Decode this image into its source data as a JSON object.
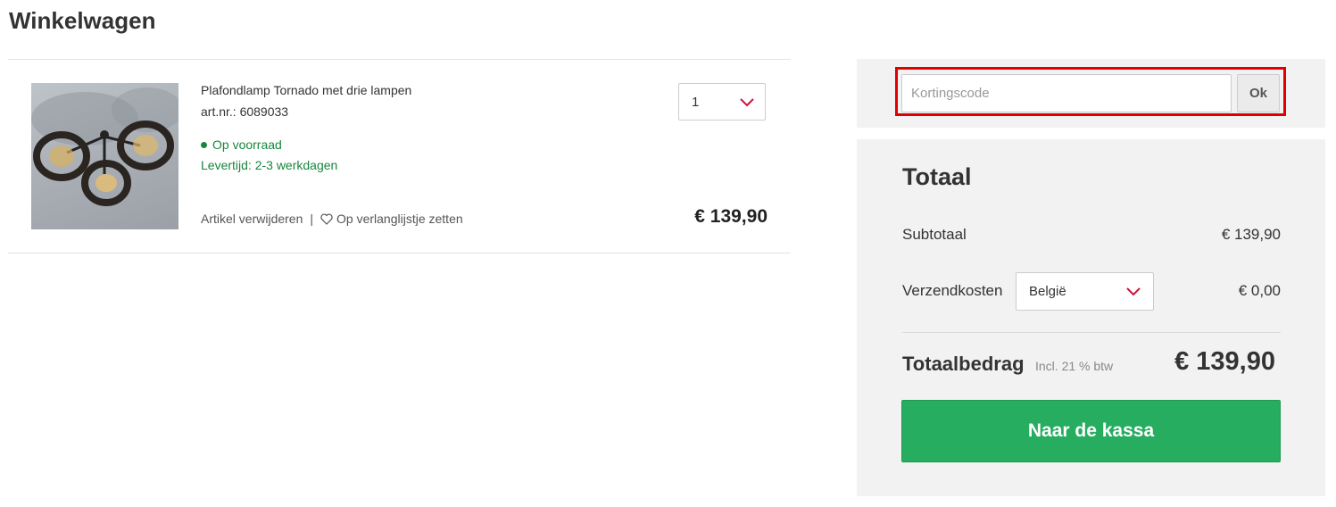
{
  "page": {
    "title": "Winkelwagen"
  },
  "cart_item": {
    "name": "Plafondlamp Tornado met drie lampen",
    "sku": "art.nr.: 6089033",
    "stock": "Op voorraad",
    "delivery": "Levertijd: 2-3 werkdagen",
    "remove_label": "Artikel verwijderen",
    "separator": "|",
    "wishlist_label": "Op verlanglijstje zetten",
    "quantity": "1",
    "price": "€ 139,90"
  },
  "coupon": {
    "placeholder": "Kortingscode",
    "button_label": "Ok"
  },
  "totals": {
    "title": "Totaal",
    "subtotal_label": "Subtotaal",
    "subtotal_value": "€ 139,90",
    "shipping_label": "Verzendkosten",
    "shipping_country": "België",
    "shipping_value": "€ 0,00",
    "grand_label": "Totaalbedrag",
    "vat_note": "Incl. 21 % btw",
    "grand_value": "€ 139,90",
    "checkout_label": "Naar de kassa"
  },
  "colors": {
    "accent_green": "#27ad5f",
    "stock_green": "#16873c",
    "chevron_red": "#d0103a",
    "highlight_red": "#e10000"
  },
  "icons": [
    "chevron-down-icon",
    "heart-icon",
    "stock-dot-icon"
  ]
}
